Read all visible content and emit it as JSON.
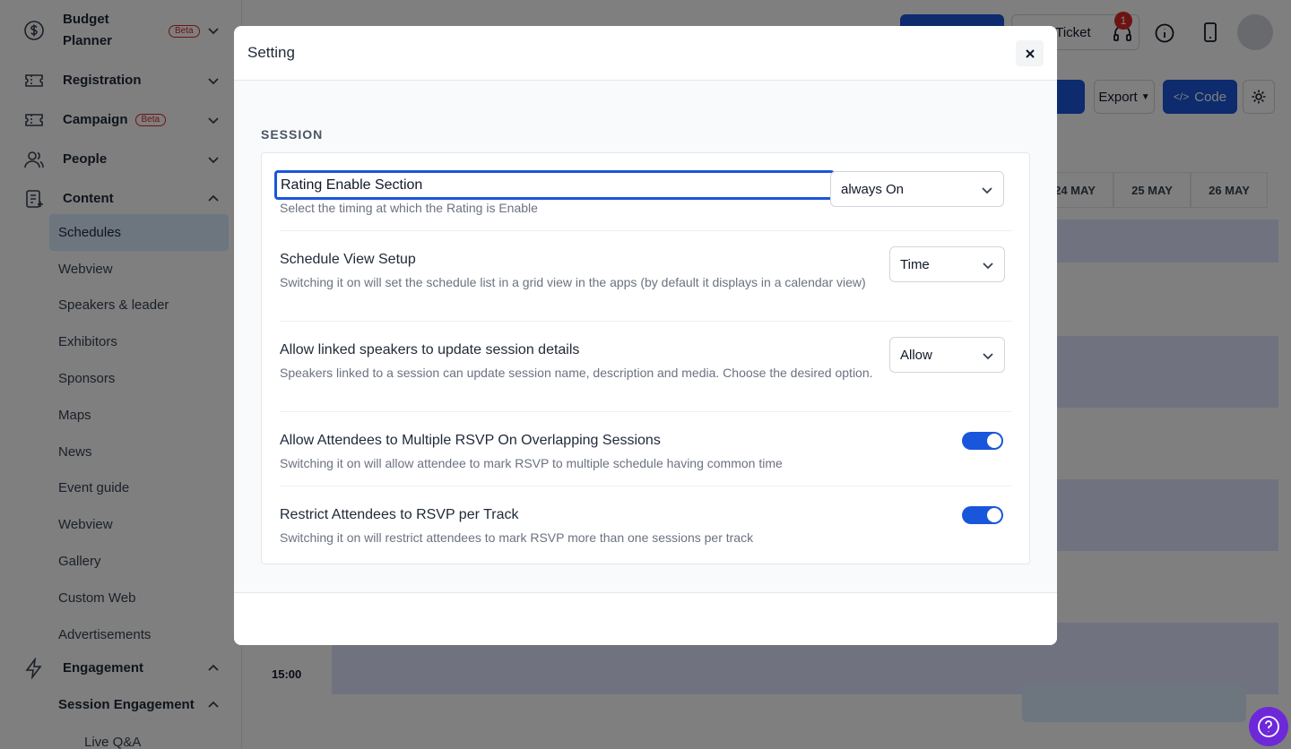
{
  "sidebar": {
    "groups": [
      {
        "label_line1": "Budget",
        "label_line2": "Planner",
        "badge": "Beta",
        "icon": "dollar-circle-icon"
      },
      {
        "label": "Registration",
        "icon": "ticket-icon"
      },
      {
        "label": "Campaign",
        "badge": "Beta",
        "icon": "ticket-icon"
      },
      {
        "label": "People",
        "icon": "people-icon"
      },
      {
        "label": "Content",
        "icon": "content-icon"
      },
      {
        "label": "Engagement",
        "icon": "lightning-icon"
      }
    ],
    "content_items": [
      "Schedules",
      "Webview",
      "Speakers & leader",
      "Exhibitors",
      "Sponsors",
      "Maps",
      "News",
      "Event guide",
      "Webview",
      "Gallery",
      "Custom Web",
      "Advertisements"
    ],
    "engagement_items": [
      "Session Engagement",
      "Live Q&A"
    ]
  },
  "background": {
    "ticket_label": "a Ticket",
    "notification_count": "1",
    "export_label": "Export",
    "code_label": "Code",
    "days": [
      "24 MAY",
      "25 MAY",
      "26 MAY"
    ],
    "time_label": "15:00"
  },
  "modal": {
    "title": "Setting",
    "section_title": "SESSION",
    "rows": [
      {
        "title": "Rating Enable Section",
        "desc": "Select the timing at which the Rating is Enable",
        "control": "select",
        "value": "always On"
      },
      {
        "title": "Schedule View Setup",
        "desc": "Switching it on will set the schedule list in a grid view in the apps (by default it displays in a calendar view)",
        "control": "select",
        "value": "Time"
      },
      {
        "title": "Allow linked speakers to update session details",
        "desc": "Speakers linked to a session can update session name, description and media. Choose the desired option.",
        "control": "select",
        "value": "Allow"
      },
      {
        "title": "Allow Attendees to Multiple RSVP On Overlapping Sessions",
        "desc": "Switching it on will allow attendee to mark RSVP to multiple schedule having common time",
        "control": "toggle",
        "value": "on"
      },
      {
        "title": "Restrict Attendees to RSVP per Track",
        "desc": "Switching it on will restrict attendees to mark RSVP more than one sessions per track",
        "control": "toggle",
        "value": "on"
      }
    ]
  },
  "colors": {
    "primary": "#1a56db",
    "help": "#6d28d9",
    "badge_red": "#dc2626"
  }
}
